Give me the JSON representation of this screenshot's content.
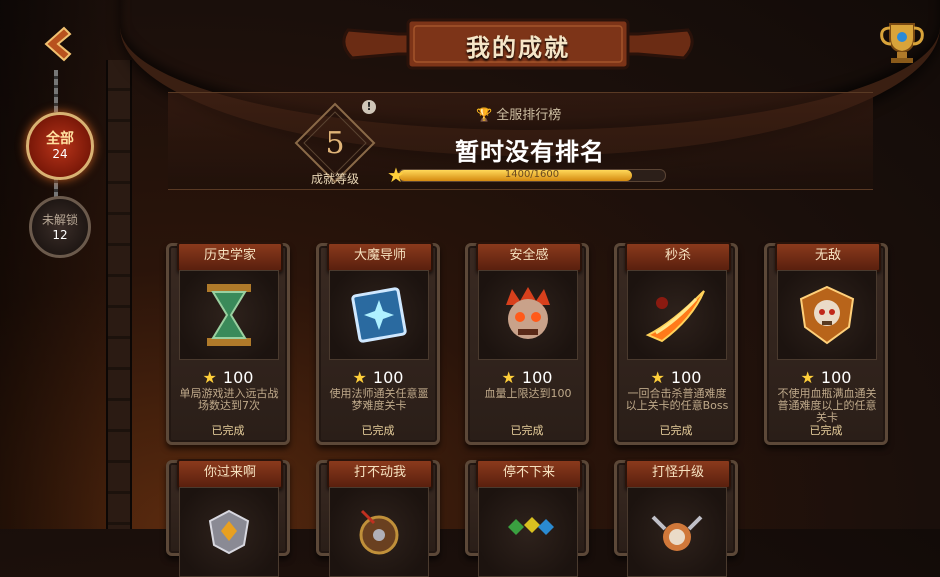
{
  "title": "我的成就",
  "filters": [
    {
      "label": "全部",
      "count": "24"
    },
    {
      "label": "未解锁",
      "count": "12"
    }
  ],
  "level": {
    "value": "5",
    "label": "成就等级"
  },
  "server_rank": {
    "label": "全服排行榜",
    "status": "暂时没有排名"
  },
  "progress": {
    "text": "1400/1600",
    "fraction": 0.875
  },
  "achievements": [
    {
      "name": "历史学家",
      "points": "100",
      "desc": "单局游戏进入远古战场数达到7次",
      "status": "已完成",
      "icon": "hourglass-icon"
    },
    {
      "name": "大魔导师",
      "points": "100",
      "desc": "使用法师通关任意噩梦难度关卡",
      "status": "已完成",
      "icon": "spellbook-icon"
    },
    {
      "name": "安全感",
      "points": "100",
      "desc": "血量上限达到100",
      "status": "已完成",
      "icon": "monster-skull-icon"
    },
    {
      "name": "秒杀",
      "points": "100",
      "desc": "一回合击杀普通难度以上关卡的任意Boss",
      "status": "已完成",
      "icon": "flaming-blade-icon"
    },
    {
      "name": "无敌",
      "points": "100",
      "desc": "不使用血瓶满血通关普通难度以上的任意关卡",
      "status": "已完成",
      "icon": "skull-shield-icon"
    },
    {
      "name": "你过来啊",
      "icon": "gem-shield-icon"
    },
    {
      "name": "打不动我",
      "icon": "round-shield-icon"
    },
    {
      "name": "停不下来",
      "icon": "gem-cluster-icon"
    },
    {
      "name": "打怪升级",
      "icon": "horned-skull-icon"
    }
  ]
}
